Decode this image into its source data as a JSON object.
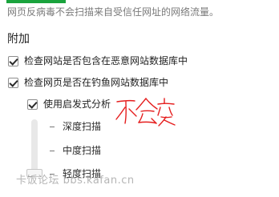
{
  "top_note": "网页反病毒不会扫描来自受信任网址的网络流量。",
  "section_title": "附加",
  "options": [
    {
      "label": "检查网站是否包含在恶意网站数据库中",
      "checked": true
    },
    {
      "label": "检查网页是否在钓鱼网站数据库中",
      "checked": true
    },
    {
      "label": "使用启发式分析",
      "checked": true
    }
  ],
  "heuristic_levels": [
    {
      "label": "深度扫描"
    },
    {
      "label": "中度扫描"
    },
    {
      "label": "轻度扫描"
    }
  ],
  "slider": {
    "selected_level": "轻度扫描"
  },
  "handwritten_note": "不会变",
  "watermark": "卡饭论坛 bbs.kafan.cn",
  "colors": {
    "accent_green": "#1aa33d",
    "handwritten_red": "#e51d1d",
    "muted_text": "#7a7a7a"
  }
}
